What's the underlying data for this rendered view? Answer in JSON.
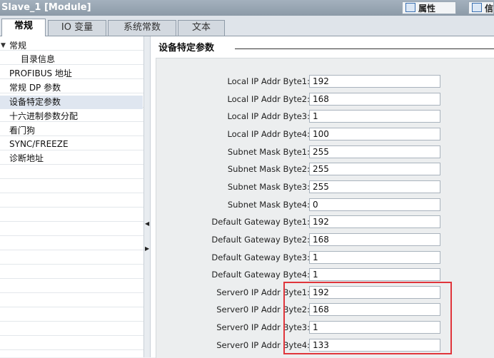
{
  "window": {
    "title": "Slave_1 [Module]",
    "properties_label": "属性",
    "info_label": "信"
  },
  "tabs": [
    {
      "label": "常规"
    },
    {
      "label": "IO 变量"
    },
    {
      "label": "系统常数"
    },
    {
      "label": "文本"
    }
  ],
  "nav": {
    "items": [
      {
        "label": "常规",
        "expanded": true
      },
      {
        "label": "目录信息"
      },
      {
        "label": "PROFIBUS 地址"
      },
      {
        "label": "常规 DP 参数"
      },
      {
        "label": "设备特定参数",
        "selected": true
      },
      {
        "label": "十六进制参数分配"
      },
      {
        "label": "看门狗"
      },
      {
        "label": "SYNC/FREEZE"
      },
      {
        "label": "诊断地址"
      }
    ]
  },
  "section": {
    "title": "设备特定参数"
  },
  "params": [
    {
      "label": "Local IP Addr Byte1:",
      "value": "192"
    },
    {
      "label": "Local IP Addr Byte2:",
      "value": "168"
    },
    {
      "label": "Local IP Addr Byte3:",
      "value": "1"
    },
    {
      "label": "Local IP Addr Byte4:",
      "value": "100"
    },
    {
      "label": "Subnet Mask Byte1:",
      "value": "255"
    },
    {
      "label": "Subnet Mask Byte2:",
      "value": "255"
    },
    {
      "label": "Subnet Mask Byte3:",
      "value": "255"
    },
    {
      "label": "Subnet Mask Byte4:",
      "value": "0"
    },
    {
      "label": "Default Gateway Byte1:",
      "value": "192"
    },
    {
      "label": "Default Gateway Byte2:",
      "value": "168"
    },
    {
      "label": "Default Gateway Byte3:",
      "value": "1"
    },
    {
      "label": "Default Gateway Byte4:",
      "value": "1"
    },
    {
      "label": "Server0 IP Addr Byte1:",
      "value": "192"
    },
    {
      "label": "Server0 IP Addr Byte2:",
      "value": "168"
    },
    {
      "label": "Server0 IP Addr Byte3:",
      "value": "1"
    },
    {
      "label": "Server0 IP Addr Byte4:",
      "value": "133"
    }
  ],
  "colors": {
    "highlight": "#e0353b",
    "selected_row": "#dfe6f0"
  }
}
